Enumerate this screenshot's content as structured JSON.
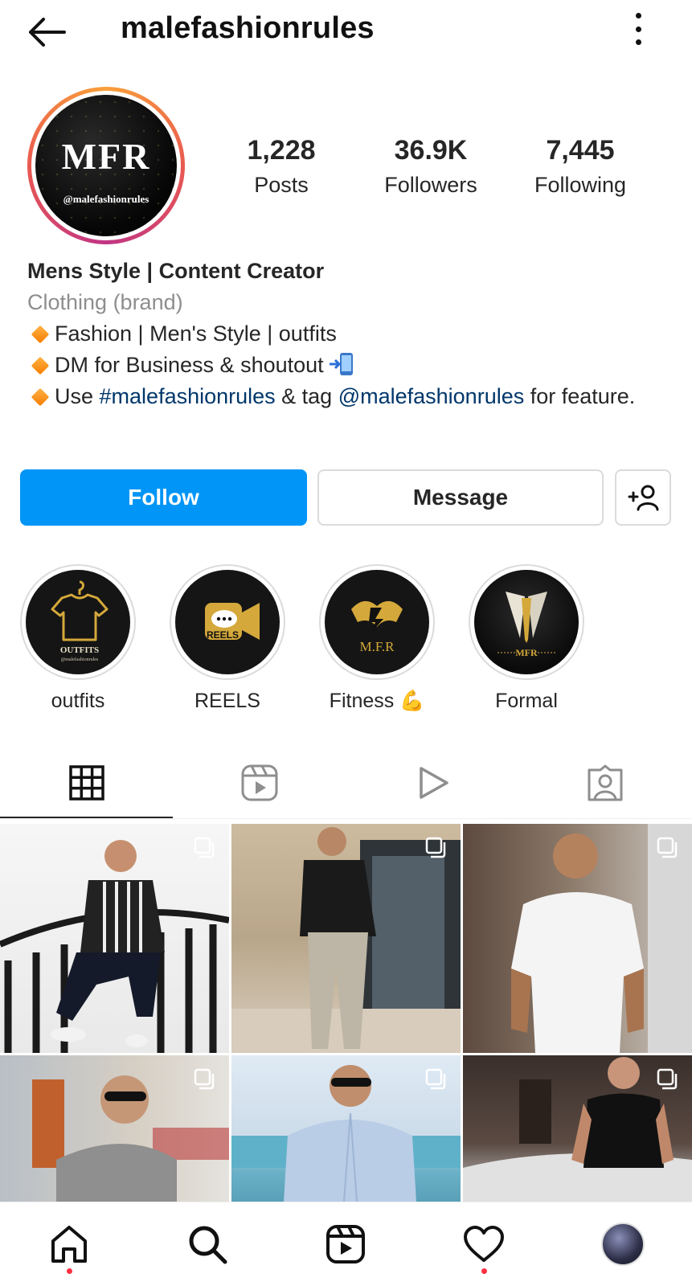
{
  "header": {
    "username": "malefashionrules",
    "back_icon": "arrow-left-icon",
    "menu_icon": "more-vertical-icon"
  },
  "avatar": {
    "logo_text": "MFR",
    "logo_handle": "@malefashionrules"
  },
  "stats": [
    {
      "value": "1,228",
      "label": "Posts"
    },
    {
      "value": "36.9K",
      "label": "Followers"
    },
    {
      "value": "7,445",
      "label": "Following"
    }
  ],
  "bio": {
    "name": "Mens Style | Content Creator",
    "category": "Clothing (brand)",
    "line1": "Fashion | Men's Style | outfits",
    "line2": "DM for Business & shoutout",
    "line3_pre": "Use ",
    "line3_hashtag": "#malefashionrules",
    "line3_mid": " & tag ",
    "line3_mention": "@malefashionrules",
    "line3_post": " for feature."
  },
  "actions": {
    "follow": "Follow",
    "message": "Message",
    "add_icon": "add-person-icon"
  },
  "highlights": [
    {
      "label": "outfits",
      "cover_text": "OUTFITS",
      "cover_sub": "@malefashionrules"
    },
    {
      "label": "REELS",
      "cover_text": "REELS"
    },
    {
      "label": "Fitness 💪",
      "cover_text": "M.F.R"
    },
    {
      "label": "Formal",
      "cover_text": "MFR"
    }
  ],
  "tabs": [
    {
      "name": "grid",
      "icon": "grid-icon",
      "active": true
    },
    {
      "name": "reels",
      "icon": "reels-icon",
      "active": false
    },
    {
      "name": "videos",
      "icon": "play-icon",
      "active": false
    },
    {
      "name": "tagged",
      "icon": "tagged-user-icon",
      "active": false
    }
  ],
  "grid_posts": 6,
  "colors": {
    "follow_blue": "#0095f6",
    "tag_link": "#00376b",
    "notification_dot": "#ff3040",
    "gold": "#d4a83a"
  },
  "bottom_nav": [
    {
      "name": "home",
      "icon": "home-icon",
      "badge": true
    },
    {
      "name": "search",
      "icon": "search-icon",
      "badge": false
    },
    {
      "name": "reels",
      "icon": "reels-icon",
      "badge": false
    },
    {
      "name": "activity",
      "icon": "heart-icon",
      "badge": true
    },
    {
      "name": "profile",
      "icon": "profile-avatar",
      "badge": false
    }
  ]
}
